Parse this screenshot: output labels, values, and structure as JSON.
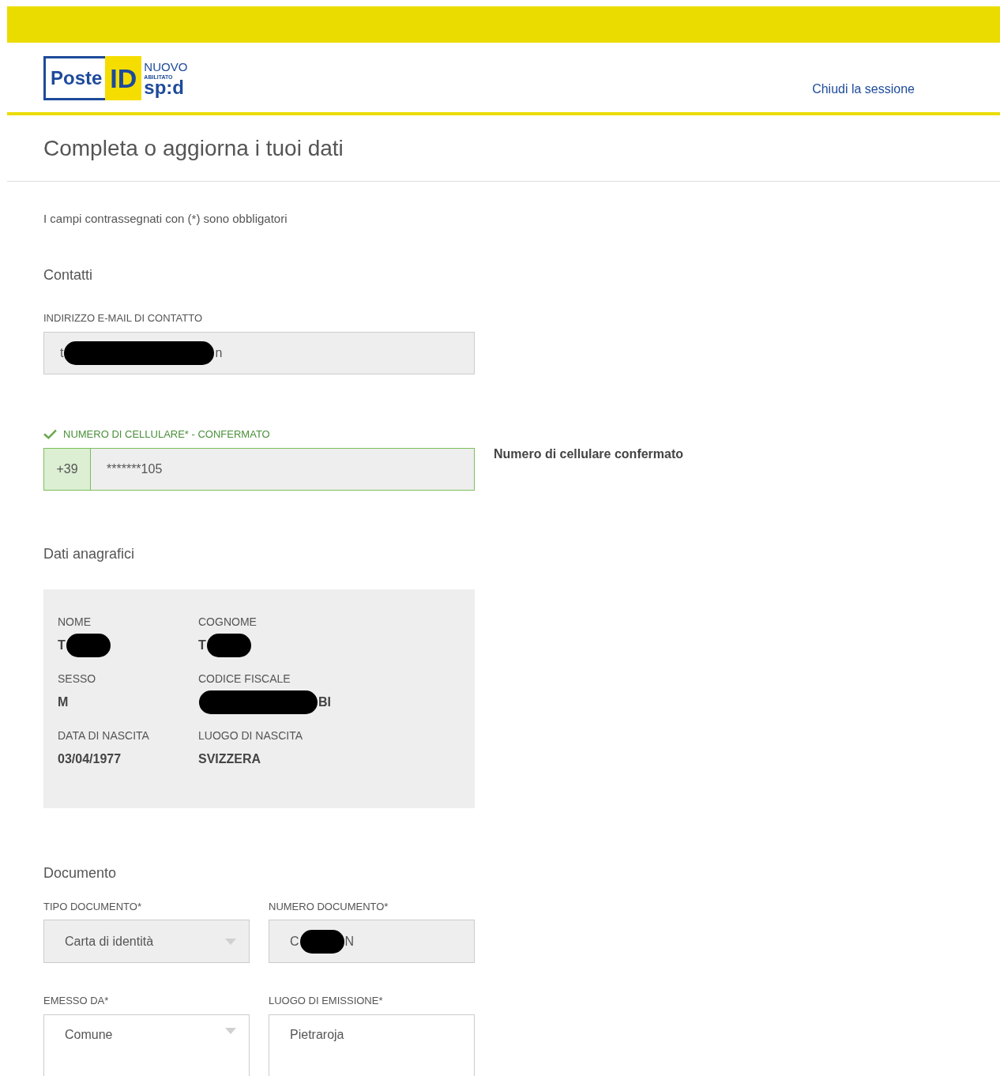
{
  "header": {
    "logo": {
      "poste": "Poste",
      "id": "ID",
      "nuovo": "NUOVO",
      "abilitato": "ABILITATO",
      "spid": "sp:d"
    },
    "logout_link": "Chiudi la sessione"
  },
  "page_title": "Completa o aggiorna i tuoi dati",
  "required_note": "I campi contrassegnati con (*) sono obbligatori",
  "contacts": {
    "heading": "Contatti",
    "email": {
      "label": "INDIRIZZO E-MAIL DI CONTATTO",
      "value_start": "t",
      "value_end": "n",
      "redacted": true
    },
    "phone": {
      "label": "NUMERO DI CELLULARE* - CONFERMATO",
      "confirmed": true,
      "prefix": "+39",
      "value": "*******105",
      "confirmation": "Numero di cellulare confermato"
    }
  },
  "personal_data": {
    "heading": "Dati anagrafici",
    "items": [
      {
        "label": "NOME",
        "value_start": "T",
        "redacted": true
      },
      {
        "label": "COGNOME",
        "value_start": "T",
        "redacted": true
      },
      {
        "label": "SESSO",
        "value_start": "M"
      },
      {
        "label": "CODICE FISCALE",
        "value_end": "BI",
        "redacted": true
      },
      {
        "label": "DATA DI NASCITA",
        "value_start": "03/04/1977"
      },
      {
        "label": "LUOGO DI NASCITA",
        "value_start": "SVIZZERA"
      }
    ]
  },
  "document": {
    "heading": "Documento",
    "fields": [
      {
        "kind": "select",
        "label": "TIPO DOCUMENTO*",
        "value_start": "Carta di identità",
        "disabled": true
      },
      {
        "kind": "text",
        "label": "NUMERO DOCUMENTO*",
        "value_start": "C",
        "value_end": "N",
        "redacted": true,
        "disabled": true
      },
      {
        "kind": "select",
        "label": "EMESSO DA*",
        "value_start": "Comune",
        "disabled": false
      },
      {
        "kind": "text",
        "label": "LUOGO DI EMISSIONE*",
        "value_start": "Pietraroja",
        "disabled": false
      }
    ]
  }
}
